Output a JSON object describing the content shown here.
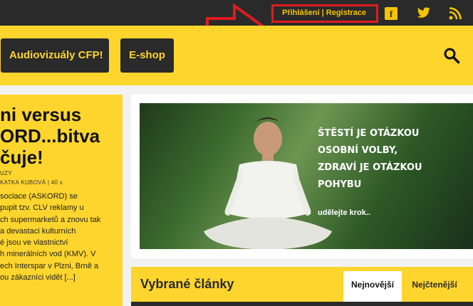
{
  "topbar": {
    "login_label": "Přihlášení",
    "separator": " | ",
    "register_label": "Registrace",
    "icons": [
      "facebook-icon",
      "twitter-icon",
      "rss-icon"
    ]
  },
  "nav": {
    "audio_label": "Audiovizuály CFP!",
    "eshop_label": "E-shop",
    "search_icon": "search-icon"
  },
  "left_article": {
    "title": "ni versus\nORD...bitva\nčuje!",
    "category": "UZY",
    "author_line": "KATKA KUBOVÁ  |  40 x",
    "excerpt": "sociace (ASKORD) se\npupit tzv. CLV reklamy u\nch supermarketů a znovu tak\na devastaci kulturních\né jsou ve vlastnictví\nh minerálních vod (KMV). V\nech Interspar v Plzni, Brně a\nou zákazníci vidět [...]"
  },
  "banner": {
    "quote": "ŠTĚSTÍ JE OTÁZKOU\nOSOBNÍ VOLBY,\nZDRAVÍ JE OTÁZKOU\nPOHYBU",
    "cta": "udělejte krok.."
  },
  "featured": {
    "title": "Vybrané články",
    "tabs": [
      "Nejnovější",
      "Nejčtenější"
    ]
  },
  "colors": {
    "accent": "#fdd52d",
    "dark": "#2a2a2a",
    "highlight": "#e01b22"
  }
}
